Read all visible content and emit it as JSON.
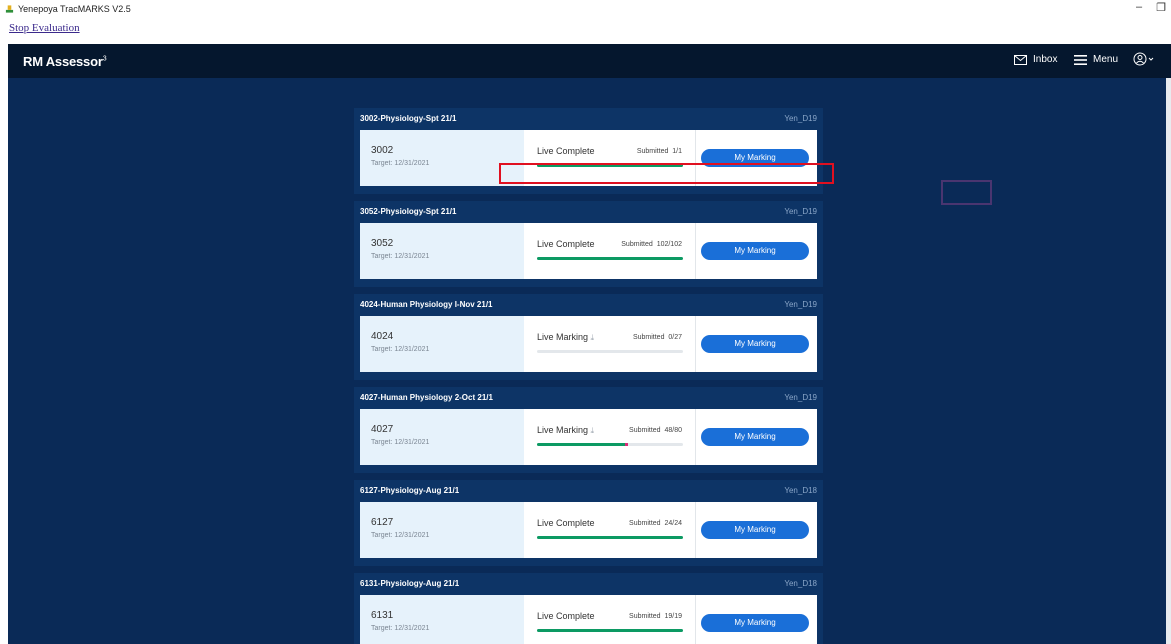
{
  "window": {
    "title": "Yenepoya TracMARKS V2.5",
    "link": "Stop Evaluation"
  },
  "app": {
    "brand": "RM Assessor",
    "brand_sup": "3",
    "inbox_label": "Inbox",
    "menu_label": "Menu"
  },
  "button_label": "My Marking",
  "submitted_label": "Submitted",
  "cards": [
    {
      "title": "3002-Physiology-Spt 21/1",
      "user": "Yen_D19",
      "qig": "3002",
      "target": "Target: 12/31/2021",
      "status": "Live Complete",
      "submitted": "1/1",
      "progress": 1.0,
      "error": 0
    },
    {
      "title": "3052-Physiology-Spt 21/1",
      "user": "Yen_D19",
      "qig": "3052",
      "target": "Target: 12/31/2021",
      "status": "Live Complete",
      "submitted": "102/102",
      "progress": 1.0,
      "error": 0
    },
    {
      "title": "4024-Human Physiology I-Nov 21/1",
      "user": "Yen_D19",
      "qig": "4024",
      "target": "Target: 12/31/2021",
      "status": "Live Marking",
      "submitted": "0/27",
      "progress": 0.0,
      "error": 0
    },
    {
      "title": "4027-Human Physiology 2-Oct 21/1",
      "user": "Yen_D19",
      "qig": "4027",
      "target": "Target: 12/31/2021",
      "status": "Live Marking",
      "submitted": "48/80",
      "progress": 0.6,
      "error": 0.02
    },
    {
      "title": "6127-Physiology-Aug 21/1",
      "user": "Yen_D18",
      "qig": "6127",
      "target": "Target: 12/31/2021",
      "status": "Live Complete",
      "submitted": "24/24",
      "progress": 1.0,
      "error": 0
    },
    {
      "title": "6131-Physiology-Aug 21/1",
      "user": "Yen_D18",
      "qig": "6131",
      "target": "Target: 12/31/2021",
      "status": "Live Complete",
      "submitted": "19/19",
      "progress": 1.0,
      "error": 0
    }
  ]
}
